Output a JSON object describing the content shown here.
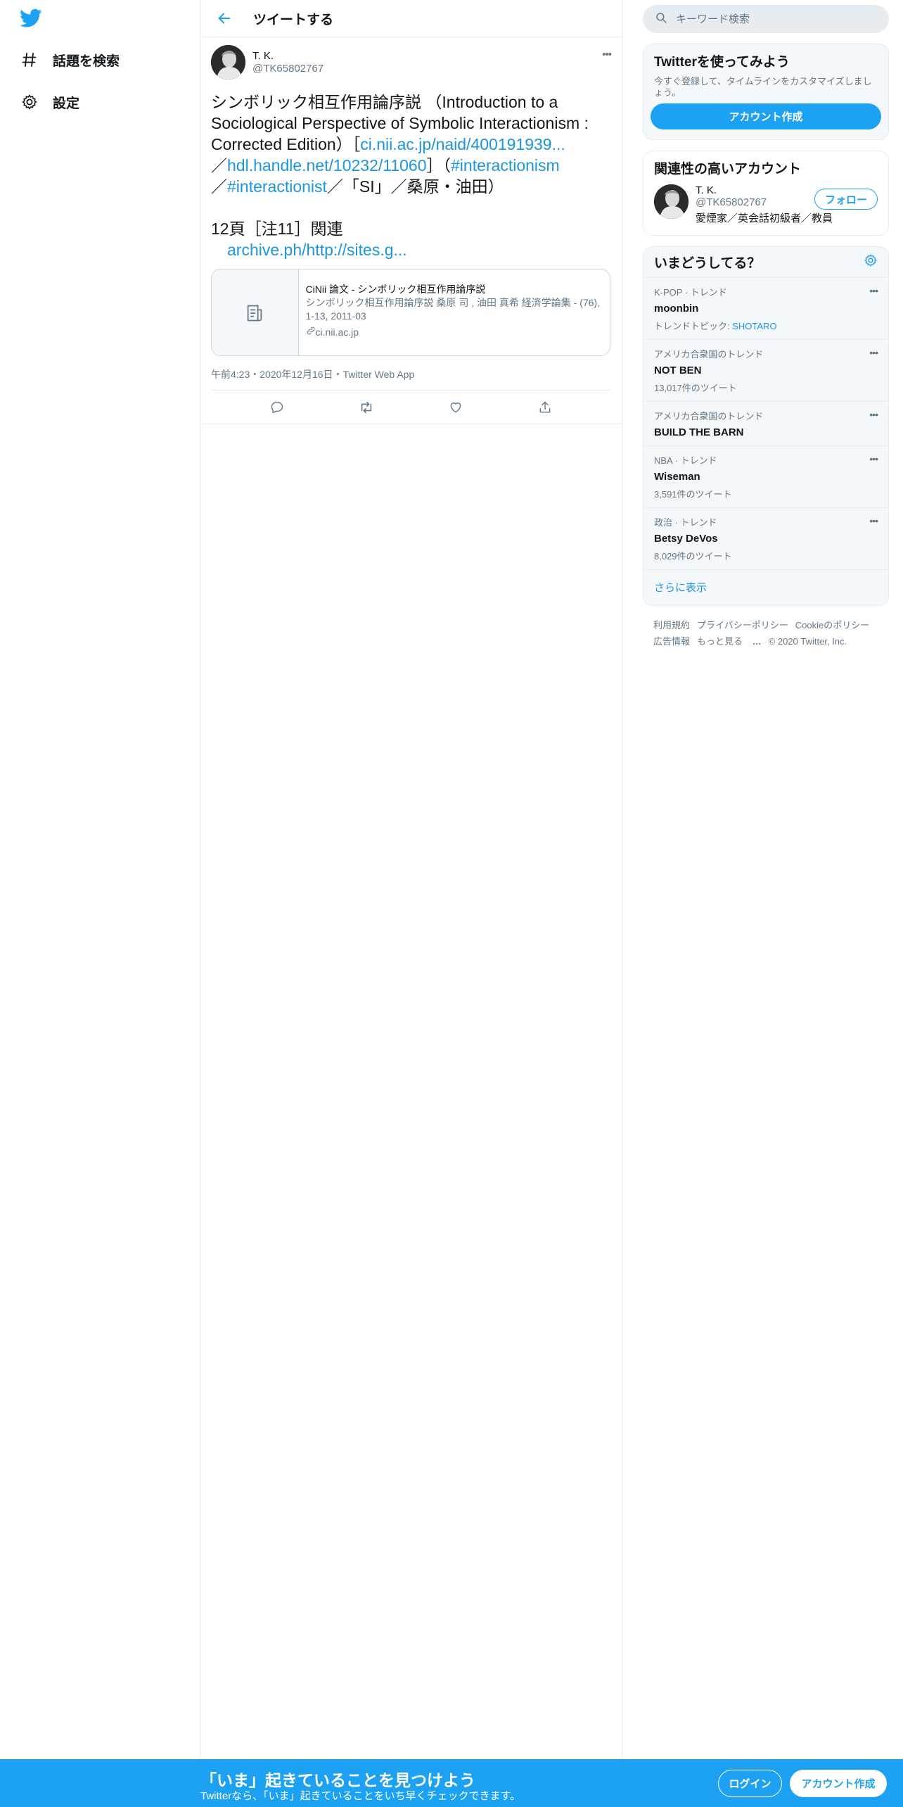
{
  "nav": {
    "items": [
      {
        "label": "話題を検索",
        "icon": "hashtag-icon"
      },
      {
        "label": "設定",
        "icon": "gear-icon"
      }
    ]
  },
  "header": {
    "title": "ツイートする"
  },
  "tweet": {
    "author_name": "T. K.",
    "author_handle": "@TK65802767",
    "text": {
      "l1": "シンボリック相互作用論序説 （Introduction to a",
      "l2": "Sociological Perspective of Symbolic Interactionism :",
      "l3_a": "Corrected Edition）［",
      "l3_link": "ci.nii.ac.jp/naid/400191939...",
      "l4_a": "／",
      "l4_link": "hdl.handle.net/10232/11060",
      "l4_b": "］（",
      "l4_tag": "#interactionism",
      "l5_a": "／",
      "l5_tag": "#interactionist",
      "l5_b": "／「SI」／桑原・油田）",
      "l6": "12頁［注11］関連",
      "l7_link": "archive.ph/http://sites.g..."
    },
    "card": {
      "title": "CiNii 論文 - シンボリック相互作用論序説",
      "desc": "シンボリック相互作用論序説 桑原 司 , 油田 真希 経済学論集 - (76), 1-13, 2011-03",
      "domain": "ci.nii.ac.jp"
    },
    "time": "午前4:23・2020年12月16日・",
    "app": "Twitter Web App"
  },
  "search": {
    "placeholder": "キーワード検索"
  },
  "signup_box": {
    "title": "Twitterを使ってみよう",
    "desc": "今すぐ登録して、タイムラインをカスタマイズしましょう。",
    "button": "アカウント作成"
  },
  "related": {
    "title": "関連性の高いアカウント",
    "name": "T. K.",
    "handle": "@TK65802767",
    "bio": "愛煙家／英会話初級者／教員",
    "follow": "フォロー"
  },
  "trends": {
    "title": "いまどうしてる？",
    "items": [
      {
        "meta": "K-POP · トレンド",
        "name": "moonbin",
        "sub_prefix": "トレンドトピック: ",
        "sub_topic": "SHOTARO"
      },
      {
        "meta": "アメリカ合衆国のトレンド",
        "name": "NOT BEN",
        "sub": "13,017件のツイート"
      },
      {
        "meta": "アメリカ合衆国のトレンド",
        "name": "BUILD THE BARN"
      },
      {
        "meta": "NBA · トレンド",
        "name": "Wiseman",
        "sub": "3,591件のツイート"
      },
      {
        "meta": "政治 · トレンド",
        "name": "Betsy DeVos",
        "sub": "8,029件のツイート"
      }
    ],
    "show_more": "さらに表示"
  },
  "footer": {
    "terms": "利用規約",
    "privacy": "プライバシーポリシー",
    "cookie": "Cookieのポリシー",
    "ads": "広告情報",
    "more": "もっと見る",
    "copyright": "© 2020 Twitter, Inc."
  },
  "bottom": {
    "title": "「いま」起きていることを見つけよう",
    "sub": "Twitterなら、「いま」起きていることをいち早くチェックできます。",
    "login": "ログイン",
    "signup": "アカウント作成"
  },
  "colors": {
    "accent": "#1da1f2",
    "link": "#1b95e0",
    "muted": "#657786",
    "border": "#e6ecf0"
  }
}
